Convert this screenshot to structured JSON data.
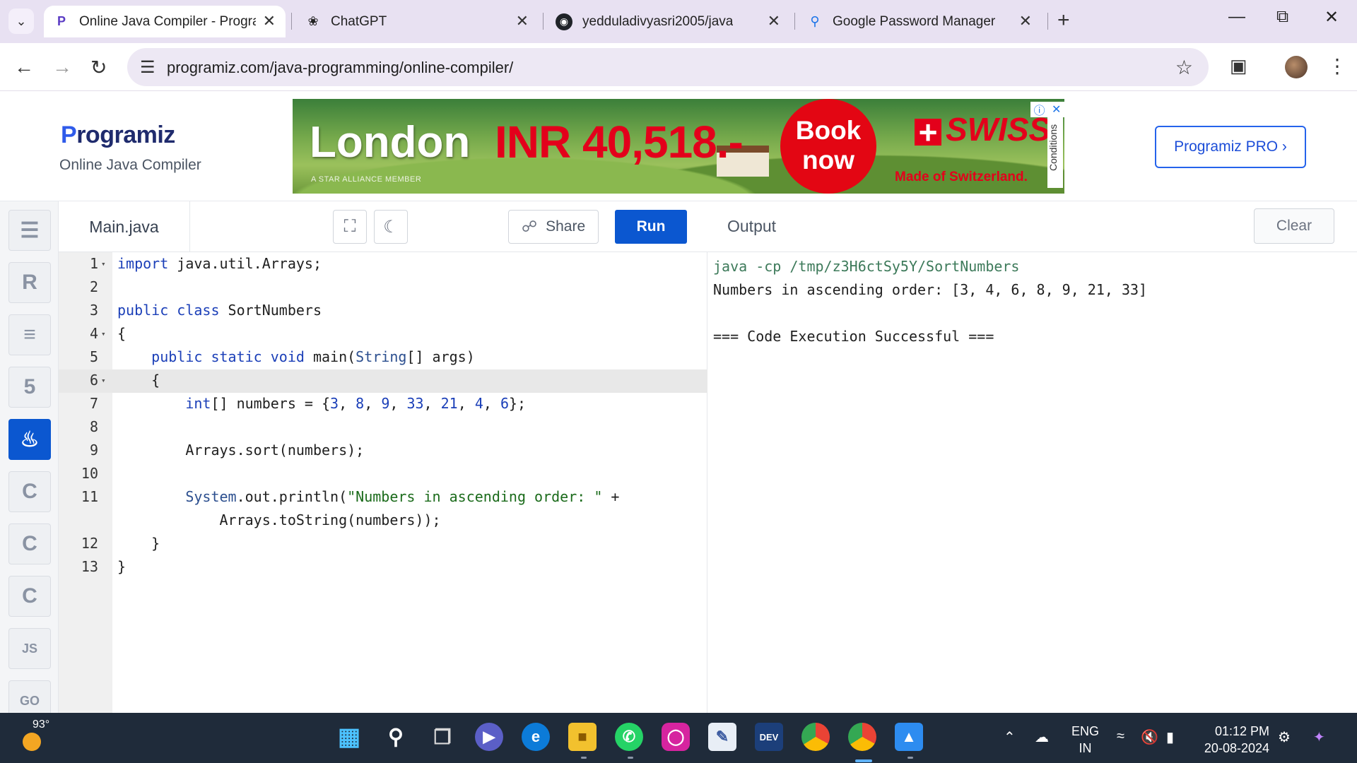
{
  "browser": {
    "tabs": [
      {
        "title": "Online Java Compiler - Program",
        "favicon": "programiz-p-icon",
        "active": true
      },
      {
        "title": "ChatGPT",
        "favicon": "chatgpt-icon",
        "active": false
      },
      {
        "title": "yedduladivyasri2005/java",
        "favicon": "github-icon",
        "active": false
      },
      {
        "title": "Google Password Manager",
        "favicon": "key-icon",
        "active": false
      }
    ],
    "url": "programiz.com/java-programming/online-compiler/"
  },
  "site": {
    "logo": "Programiz",
    "logo_first": "P",
    "logo_rest": "rogramiz",
    "subtitle": "Online Java Compiler",
    "pro_button": "Programiz PRO ›",
    "ad": {
      "city": "London",
      "price": "INR 40,518.-",
      "book": "Book",
      "book2": "now",
      "brand": "SWISS",
      "made": "Made of Switzerland.",
      "member": "A STAR ALLIANCE MEMBER",
      "conditions": "Conditions"
    }
  },
  "rail": {
    "items": [
      {
        "name": "python-icon",
        "glyph": "☰",
        "active": false
      },
      {
        "name": "r-icon",
        "glyph": "R",
        "active": false
      },
      {
        "name": "sql-database-icon",
        "glyph": "≡",
        "active": false
      },
      {
        "name": "html5-icon",
        "glyph": "5",
        "active": false
      },
      {
        "name": "java-icon",
        "glyph": "♨",
        "active": true
      },
      {
        "name": "c-icon",
        "glyph": "C",
        "active": false
      },
      {
        "name": "cpp-icon",
        "glyph": "C",
        "active": false
      },
      {
        "name": "csharp-icon",
        "glyph": "C",
        "active": false
      },
      {
        "name": "javascript-icon",
        "glyph": "JS",
        "active": false
      },
      {
        "name": "go-icon",
        "glyph": "GO",
        "active": false
      }
    ]
  },
  "editor": {
    "file_name": "Main.java",
    "share_label": "Share",
    "run_label": "Run",
    "active_line": 6,
    "lines": [
      {
        "n": "1",
        "fold": true,
        "html": "<span class=\"kw\">import</span> java.util.Arrays;"
      },
      {
        "n": "2",
        "fold": false,
        "html": ""
      },
      {
        "n": "3",
        "fold": false,
        "html": "<span class=\"kw\">public class</span> SortNumbers"
      },
      {
        "n": "4",
        "fold": true,
        "html": "{"
      },
      {
        "n": "5",
        "fold": false,
        "html": "    <span class=\"kw\">public static void</span> main(<span class=\"ty\">String</span>[] args)"
      },
      {
        "n": "6",
        "fold": true,
        "html": "    {"
      },
      {
        "n": "7",
        "fold": false,
        "html": "        <span class=\"kw\">int</span>[] numbers = {<span class=\"num\">3</span>, <span class=\"num\">8</span>, <span class=\"num\">9</span>, <span class=\"num\">33</span>, <span class=\"num\">21</span>, <span class=\"num\">4</span>, <span class=\"num\">6</span>};"
      },
      {
        "n": "8",
        "fold": false,
        "html": ""
      },
      {
        "n": "9",
        "fold": false,
        "html": "        Arrays.sort(numbers);"
      },
      {
        "n": "10",
        "fold": false,
        "html": ""
      },
      {
        "n": "11",
        "fold": false,
        "html": "        <span class=\"ty\">System</span>.out.println(<span class=\"str\">\"Numbers in ascending order: \"</span> +"
      },
      {
        "n": "",
        "fold": false,
        "html": "            Arrays.toString(numbers));"
      },
      {
        "n": "12",
        "fold": false,
        "html": "    }"
      },
      {
        "n": "13",
        "fold": false,
        "html": "}"
      }
    ]
  },
  "output": {
    "title": "Output",
    "clear_label": "Clear",
    "lines": [
      {
        "text": "java -cp /tmp/z3H6ctSy5Y/SortNumbers",
        "cmd": true
      },
      {
        "text": "Numbers in ascending order: [3, 4, 6, 8, 9, 21, 33]",
        "cmd": false
      },
      {
        "text": "",
        "cmd": false
      },
      {
        "text": "=== Code Execution Successful ===",
        "cmd": false
      }
    ]
  },
  "taskbar": {
    "temperature": "93°",
    "language": "ENG",
    "region": "IN",
    "time": "01:12 PM",
    "date": "20-08-2024"
  }
}
